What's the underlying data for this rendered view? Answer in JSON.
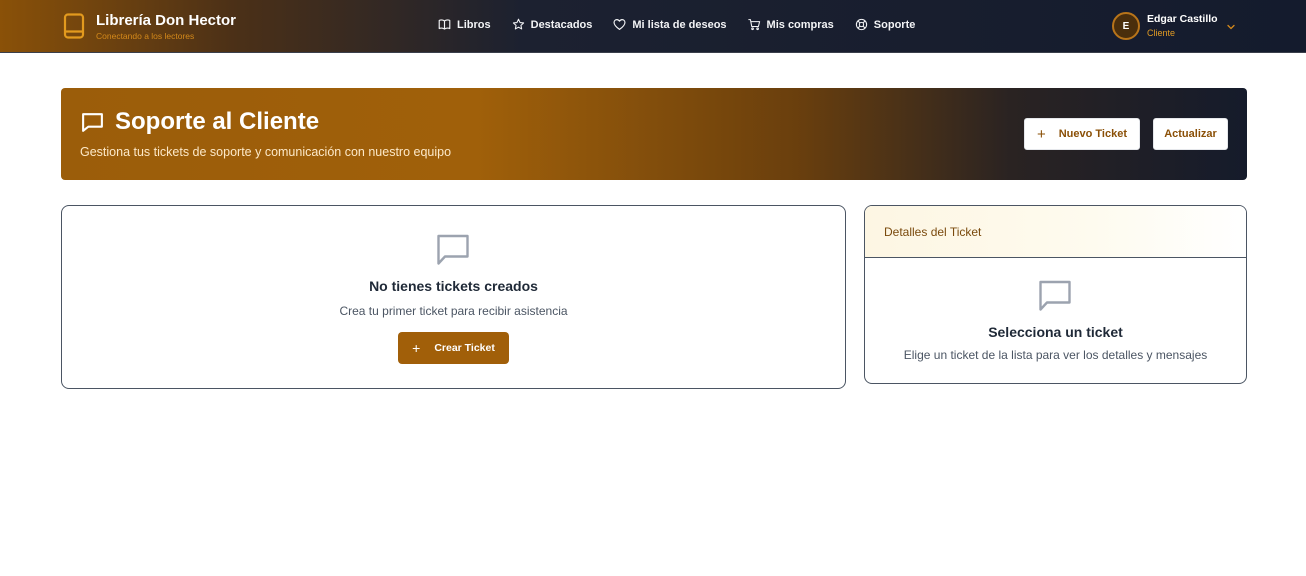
{
  "brand": {
    "name": "Librería Don Hector",
    "tagline": "Conectando a los lectores"
  },
  "nav": {
    "items": [
      {
        "label": "Libros",
        "icon": "book-open-icon"
      },
      {
        "label": "Destacados",
        "icon": "star-icon"
      },
      {
        "label": "Mi lista de deseos",
        "icon": "heart-icon"
      },
      {
        "label": "Mis compras",
        "icon": "cart-icon"
      },
      {
        "label": "Soporte",
        "icon": "lifebuoy-icon"
      }
    ]
  },
  "user": {
    "initial": "E",
    "name": "Edgar Castillo",
    "role": "Cliente"
  },
  "hero": {
    "title": "Soporte al Cliente",
    "subtitle": "Gestiona tus tickets de soporte y comunicación con nuestro equipo",
    "new_ticket_label": "Nuevo Ticket",
    "refresh_label": "Actualizar"
  },
  "tickets_list": {
    "empty_title": "No tienes tickets creados",
    "empty_subtitle": "Crea tu primer ticket para recibir asistencia",
    "create_label": "Crear Ticket"
  },
  "ticket_details": {
    "header": "Detalles del Ticket",
    "empty_title": "Selecciona un ticket",
    "empty_subtitle": "Elige un ticket de la lista para ver los detalles y mensajes"
  },
  "colors": {
    "accent": "#a15f09",
    "navbar_dark": "#141b2d",
    "role_text": "#e09a24"
  }
}
